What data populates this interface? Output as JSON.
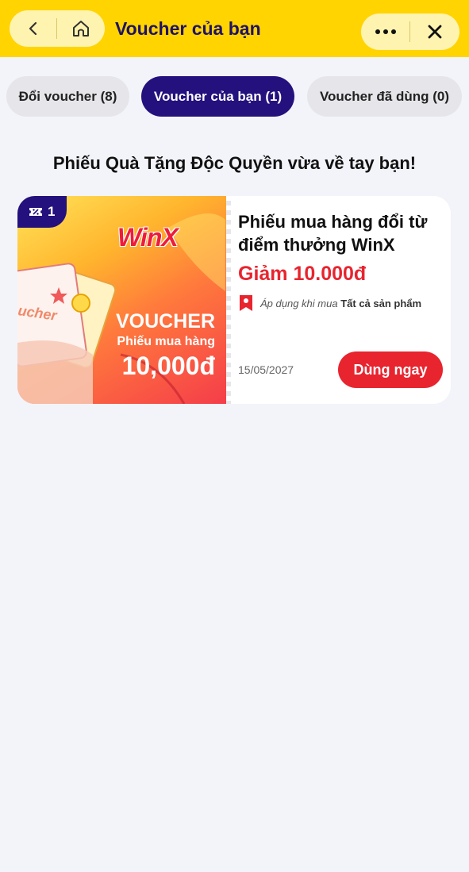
{
  "header": {
    "title": "Voucher của bạn",
    "back_icon": "chevron-left-icon",
    "home_icon": "home-icon",
    "more_icon": "more-dots-icon",
    "close_icon": "close-icon",
    "bg_color": "#ffd400"
  },
  "tabs": [
    {
      "label": "Đổi voucher (8)",
      "active": false
    },
    {
      "label": "Voucher của bạn (1)",
      "active": true
    },
    {
      "label": "Voucher đã dùng (0)",
      "active": false
    }
  ],
  "section_title": "Phiếu Quà Tặng Độc Quyền vừa về tay bạn!",
  "voucher": {
    "badge_count": "1",
    "brand_logo": "WinX",
    "image_title": "VOUCHER",
    "image_subtitle": "Phiếu mua hàng",
    "image_amount": "10,000đ",
    "name": "Phiếu mua hàng đổi từ điểm thưởng WinX",
    "discount": "Giảm 10.000đ",
    "apply_prefix": "Áp dụng khi mua",
    "apply_scope": "Tất cả sản phẩm",
    "expiry": "15/05/2027",
    "use_button": "Dùng ngay"
  },
  "colors": {
    "primary": "#24117e",
    "accent_red": "#e8242f",
    "yellow": "#ffd400",
    "background": "#f3f4f9"
  }
}
